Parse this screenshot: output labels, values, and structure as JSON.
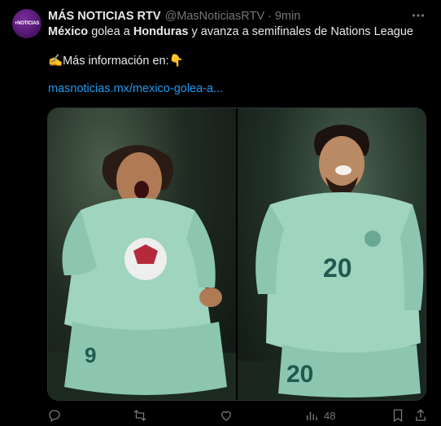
{
  "account": {
    "name": "MÁS NOTICIAS RTV",
    "handle": "@MasNoticiasRTV",
    "separator": "·",
    "time": "9min",
    "avatar_text": "+NOTICIAS"
  },
  "tweet": {
    "line1": {
      "part1": "México",
      "part2": " golea a ",
      "part3": "Honduras",
      "part4": " y avanza a semifinales de Nations League"
    },
    "line2": {
      "emoji_hand": "✍️",
      "text": "Más información en:",
      "emoji_point": "👇"
    },
    "link": "masnoticias.mx/mexico-golea-a..."
  },
  "media": {
    "left_jersey_number": "9",
    "right_jersey_number_chest": "20",
    "right_jersey_number_shorts": "20"
  },
  "actions": {
    "views": "48"
  },
  "colors": {
    "background": "#000000",
    "text": "#e7e9ea",
    "muted": "#71767b",
    "link": "#1d9bf0",
    "avatar": "#5a1b7a",
    "jersey": "#9fd4bf"
  }
}
